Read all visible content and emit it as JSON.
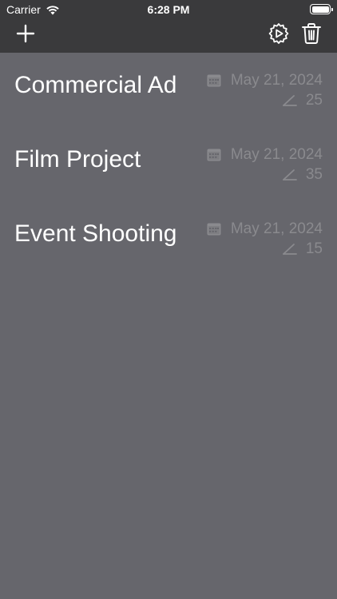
{
  "status_bar": {
    "carrier": "Carrier",
    "time": "6:28 PM"
  },
  "nav": {
    "left_icon": "plus-icon",
    "right_icons": [
      "settings-play-icon",
      "trash-icon"
    ]
  },
  "items": [
    {
      "title": "Commercial Ad",
      "date": "May 21, 2024",
      "count": "25"
    },
    {
      "title": "Film Project",
      "date": "May 21, 2024",
      "count": "35"
    },
    {
      "title": "Event Shooting",
      "date": "May 21, 2024",
      "count": "15"
    }
  ],
  "colors": {
    "background": "#66666c",
    "nav_bar": "#3a3a3c",
    "secondary_text": "#8a8a8e"
  }
}
